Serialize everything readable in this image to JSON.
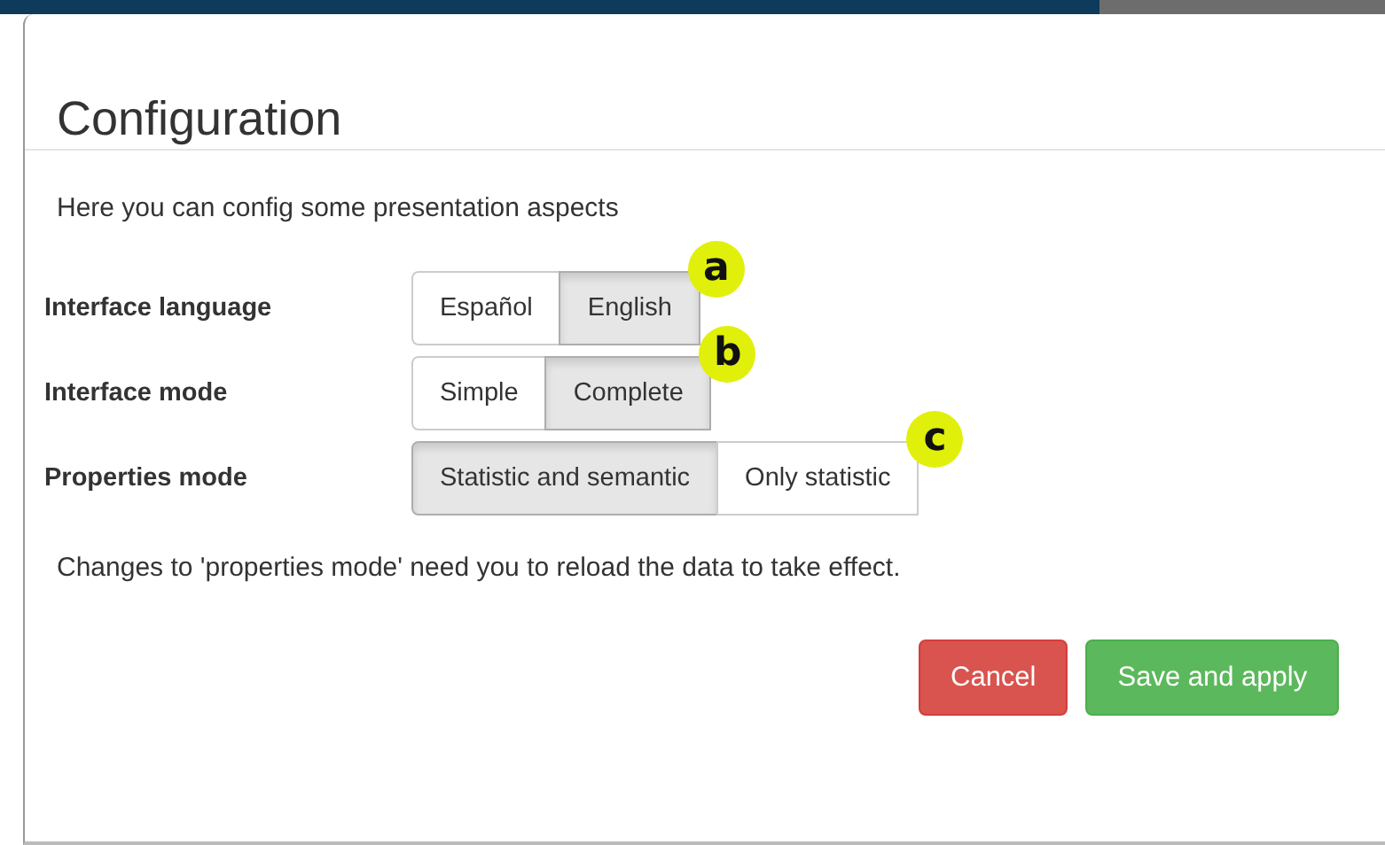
{
  "dialog": {
    "title": "Configuration",
    "intro": "Here you can config some presentation aspects",
    "settings": [
      {
        "label": "Interface language",
        "marker": "a",
        "options": [
          {
            "label": "Español",
            "selected": false
          },
          {
            "label": "English",
            "selected": true
          }
        ]
      },
      {
        "label": "Interface mode",
        "marker": "b",
        "options": [
          {
            "label": "Simple",
            "selected": false
          },
          {
            "label": "Complete",
            "selected": true
          }
        ]
      },
      {
        "label": "Properties mode",
        "marker": "c",
        "options": [
          {
            "label": "Statistic and semantic",
            "selected": true
          },
          {
            "label": "Only statistic",
            "selected": false
          }
        ]
      }
    ],
    "note": "Changes to 'properties mode' need you to reload the data to take effect.",
    "buttons": [
      {
        "label": "Cancel",
        "kind": "danger"
      },
      {
        "label": "Save and apply",
        "kind": "success"
      }
    ]
  }
}
